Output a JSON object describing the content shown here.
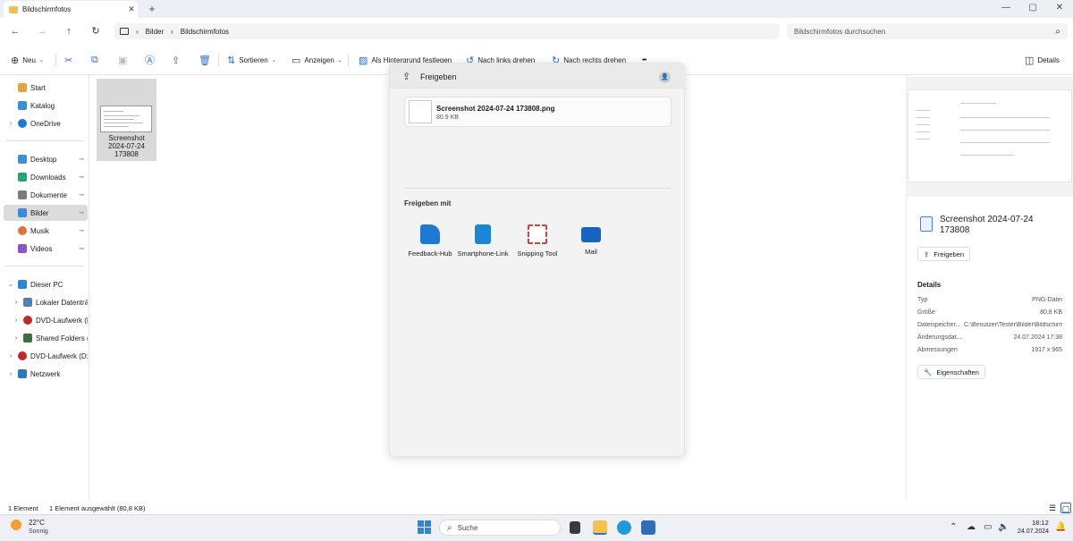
{
  "tab": {
    "title": "Bildschirmfotos",
    "close": "✕",
    "new": "+"
  },
  "window": {
    "minimize": "—",
    "maximize": "▢",
    "close": "✕"
  },
  "nav": {
    "back": "←",
    "forward": "→",
    "up": "↑",
    "refresh": "↻"
  },
  "breadcrumb": {
    "root_icon": "monitor-icon",
    "sep": "›",
    "items": [
      "Bilder",
      "Bildschirmfotos"
    ]
  },
  "search": {
    "placeholder": "Bildschirmfotos durchsuchen",
    "icon": "⌕"
  },
  "toolbar": {
    "new": "Neu",
    "sort": "Sortieren",
    "view": "Anzeigen",
    "background": "Als Hintergrund festlegen",
    "rotate_left": "Nach links drehen",
    "rotate_right": "Nach rechts drehen",
    "more": "•••",
    "details": "Details"
  },
  "sidebar": {
    "quick": [
      {
        "label": "Start",
        "color": "#e6a43a"
      },
      {
        "label": "Katalog",
        "color": "#3c8ed8"
      },
      {
        "label": "OneDrive",
        "color": "#1e78d6"
      }
    ],
    "pinned": [
      {
        "label": "Desktop",
        "color": "#3d8fd6"
      },
      {
        "label": "Downloads",
        "color": "#27a56d"
      },
      {
        "label": "Dokumente",
        "color": "#7b7b7b"
      },
      {
        "label": "Bilder",
        "color": "#3b8ae0"
      },
      {
        "label": "Musik",
        "color": "#e2723a"
      },
      {
        "label": "Videos",
        "color": "#8e53c9"
      }
    ],
    "pc": [
      {
        "label": "Dieser PC",
        "color": "#2d86d1"
      },
      {
        "label": "Lokaler Datenträger (C:)",
        "color": "#4d7fb8"
      },
      {
        "label": "DVD-Laufwerk (D:)",
        "color": "#c1272d"
      },
      {
        "label": "Shared Folders (\\\\vmware-host) (Z:)",
        "color": "#3d6e3d"
      },
      {
        "label": "DVD-Laufwerk (D:)",
        "color": "#c1272d"
      },
      {
        "label": "Netzwerk",
        "color": "#2c7ac2"
      }
    ],
    "pin_glyph": "📌"
  },
  "file": {
    "name": "Screenshot 2024-07-24 173808"
  },
  "share": {
    "title": "Freigeben",
    "file_name": "Screenshot 2024-07-24 173808.png",
    "file_size": "80.9 KB",
    "with_label": "Freigeben mit",
    "apps": [
      {
        "label": "Feedback-Hub",
        "color": "#1e79d2"
      },
      {
        "label": "Smartphone-Link",
        "color": "#1b86d6"
      },
      {
        "label": "Snipping Tool",
        "color": "#d8423a"
      },
      {
        "label": "Mail",
        "color": "#1565c0"
      }
    ]
  },
  "details_pane": {
    "file_title": "Screenshot 2024-07-24 173808",
    "share_button": "Freigeben",
    "section": "Details",
    "rows": [
      {
        "key": "Typ",
        "value": "PNG-Datei"
      },
      {
        "key": "Größe",
        "value": "80,8 KB"
      },
      {
        "key": "Dateispeicher...",
        "value": "C:\\Benutzer\\Tester\\Bilder\\Bildschirmfotos"
      },
      {
        "key": "Änderungsdat...",
        "value": "24.07.2024 17:38"
      },
      {
        "key": "Abmessungen",
        "value": "1917 x 965"
      }
    ],
    "properties_button": "Eigenschaften"
  },
  "status": {
    "count": "1 Element",
    "selected": "1 Element ausgewählt (80,8 KB)"
  },
  "taskbar": {
    "temperature": "22°C",
    "condition": "Sonnig",
    "search_label": "Suche",
    "time": "18:12",
    "date": "24.07.2024"
  }
}
